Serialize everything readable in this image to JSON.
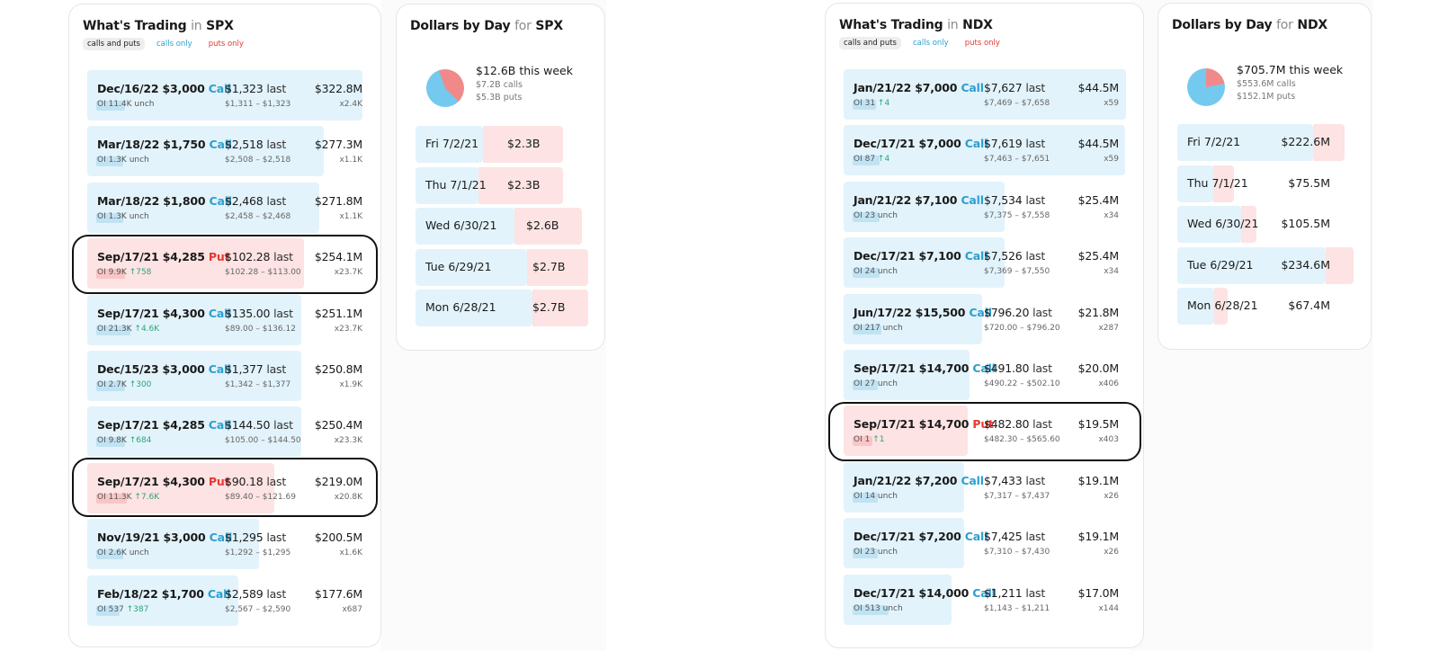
{
  "colors": {
    "call": "#2e9fd0",
    "put": "#e53935",
    "up": "#2aa57a",
    "call_fill": "#e2f3fb",
    "put_fill": "#fde3e3",
    "pie_calls": "#74c9ee",
    "pie_puts": "#f08a8a"
  },
  "panels": {
    "spx_trading": {
      "title_main": "What's Trading",
      "title_in": "in",
      "ticker": "SPX",
      "filters": [
        "calls and puts",
        "calls only",
        "puts only"
      ],
      "rows": [
        {
          "contract": "Dec/16/22 $3,000",
          "type": "Call",
          "last": "$1,323",
          "last_label": "last",
          "oi": "OI 11.4K",
          "change": "unch",
          "range": "$1,311 – $1,323",
          "premium": "$322.8M",
          "mult": "x2.4K"
        },
        {
          "contract": "Mar/18/22 $1,750",
          "type": "Call",
          "last": "$2,518",
          "last_label": "last",
          "oi": "OI 1.3K",
          "change": "unch",
          "range": "$2,508 – $2,518",
          "premium": "$277.3M",
          "mult": "x1.1K"
        },
        {
          "contract": "Mar/18/22 $1,800",
          "type": "Call",
          "last": "$2,468",
          "last_label": "last",
          "oi": "OI 1.3K",
          "change": "unch",
          "range": "$2,458 – $2,468",
          "premium": "$271.8M",
          "mult": "x1.1K"
        },
        {
          "contract": "Sep/17/21 $4,285",
          "type": "Put",
          "last": "$102.28",
          "last_label": "last",
          "oi": "OI 9.9K",
          "change": "↑758",
          "range": "$102.28 – $113.00",
          "premium": "$254.1M",
          "mult": "x23.7K"
        },
        {
          "contract": "Sep/17/21 $4,300",
          "type": "Call",
          "last": "$135.00",
          "last_label": "last",
          "oi": "OI 21.3K",
          "change": "↑4.6K",
          "range": "$89.00 – $136.12",
          "premium": "$251.1M",
          "mult": "x23.7K"
        },
        {
          "contract": "Dec/15/23 $3,000",
          "type": "Call",
          "last": "$1,377",
          "last_label": "last",
          "oi": "OI 2.7K",
          "change": "↑300",
          "range": "$1,342 – $1,377",
          "premium": "$250.8M",
          "mult": "x1.9K"
        },
        {
          "contract": "Sep/17/21 $4,285",
          "type": "Call",
          "last": "$144.50",
          "last_label": "last",
          "oi": "OI 9.8K",
          "change": "↑684",
          "range": "$105.00 – $144.50",
          "premium": "$250.4M",
          "mult": "x23.3K"
        },
        {
          "contract": "Sep/17/21 $4,300",
          "type": "Put",
          "last": "$90.18",
          "last_label": "last",
          "oi": "OI 11.3K",
          "change": "↑7.6K",
          "range": "$89.40 – $121.69",
          "premium": "$219.0M",
          "mult": "x20.8K"
        },
        {
          "contract": "Nov/19/21 $3,000",
          "type": "Call",
          "last": "$1,295",
          "last_label": "last",
          "oi": "OI 2.6K",
          "change": "unch",
          "range": "$1,292 – $1,295",
          "premium": "$200.5M",
          "mult": "x1.6K"
        },
        {
          "contract": "Feb/18/22 $1,700",
          "type": "Call",
          "last": "$2,589",
          "last_label": "last",
          "oi": "OI 537",
          "change": "↑387",
          "range": "$2,567 – $2,590",
          "premium": "$177.6M",
          "mult": "x687"
        }
      ]
    },
    "spx_days": {
      "title_main": "Dollars by Day",
      "title_for": "for",
      "ticker": "SPX",
      "summary": "$12.6B this week",
      "calls": "$7.2B calls",
      "puts": "$5.3B puts",
      "calls_share": 0.57,
      "days": [
        {
          "label": "Fri 7/2/21",
          "value": "$2.3B",
          "total": 2.3,
          "calls": 1.05
        },
        {
          "label": "Thu 7/1/21",
          "value": "$2.3B",
          "total": 2.3,
          "calls": 0.98
        },
        {
          "label": "Wed 6/30/21",
          "value": "$2.6B",
          "total": 2.6,
          "calls": 1.55
        },
        {
          "label": "Tue 6/29/21",
          "value": "$2.7B",
          "total": 2.7,
          "calls": 1.75
        },
        {
          "label": "Mon 6/28/21",
          "value": "$2.7B",
          "total": 2.7,
          "calls": 1.83
        }
      ]
    },
    "ndx_trading": {
      "title_main": "What's Trading",
      "title_in": "in",
      "ticker": "NDX",
      "filters": [
        "calls and puts",
        "calls only",
        "puts only"
      ],
      "rows": [
        {
          "contract": "Jan/21/22 $7,000",
          "type": "Call",
          "last": "$7,627",
          "last_label": "last",
          "oi": "OI 31",
          "change": "↑4",
          "range": "$7,469 – $7,658",
          "premium": "$44.5M",
          "mult": "x59"
        },
        {
          "contract": "Dec/17/21 $7,000",
          "type": "Call",
          "last": "$7,619",
          "last_label": "last",
          "oi": "OI 87",
          "change": "↑4",
          "range": "$7,463 – $7,651",
          "premium": "$44.5M",
          "mult": "x59"
        },
        {
          "contract": "Jan/21/22 $7,100",
          "type": "Call",
          "last": "$7,534",
          "last_label": "last",
          "oi": "OI 23",
          "change": "unch",
          "range": "$7,375 – $7,558",
          "premium": "$25.4M",
          "mult": "x34"
        },
        {
          "contract": "Dec/17/21 $7,100",
          "type": "Call",
          "last": "$7,526",
          "last_label": "last",
          "oi": "OI 24",
          "change": "unch",
          "range": "$7,369 – $7,550",
          "premium": "$25.4M",
          "mult": "x34"
        },
        {
          "contract": "Jun/17/22 $15,500",
          "type": "Call",
          "last": "$796.20",
          "last_label": "last",
          "oi": "OI 217",
          "change": "unch",
          "range": "$720.00 – $796.20",
          "premium": "$21.8M",
          "mult": "x287"
        },
        {
          "contract": "Sep/17/21 $14,700",
          "type": "Call",
          "last": "$491.80",
          "last_label": "last",
          "oi": "OI 27",
          "change": "unch",
          "range": "$490.22 – $502.10",
          "premium": "$20.0M",
          "mult": "x406"
        },
        {
          "contract": "Sep/17/21 $14,700",
          "type": "Put",
          "last": "$482.80",
          "last_label": "last",
          "oi": "OI 1",
          "change": "↑1",
          "range": "$482.30 – $565.60",
          "premium": "$19.5M",
          "mult": "x403"
        },
        {
          "contract": "Jan/21/22 $7,200",
          "type": "Call",
          "last": "$7,433",
          "last_label": "last",
          "oi": "OI 14",
          "change": "unch",
          "range": "$7,317 – $7,437",
          "premium": "$19.1M",
          "mult": "x26"
        },
        {
          "contract": "Dec/17/21 $7,200",
          "type": "Call",
          "last": "$7,425",
          "last_label": "last",
          "oi": "OI 23",
          "change": "unch",
          "range": "$7,310 – $7,430",
          "premium": "$19.1M",
          "mult": "x26"
        },
        {
          "contract": "Dec/17/21 $14,000",
          "type": "Call",
          "last": "$1,211",
          "last_label": "last",
          "oi": "OI 513",
          "change": "unch",
          "range": "$1,143 – $1,211",
          "premium": "$17.0M",
          "mult": "x144"
        }
      ]
    },
    "ndx_days": {
      "title_main": "Dollars by Day",
      "title_for": "for",
      "ticker": "NDX",
      "summary": "$705.7M this week",
      "calls": "$553.6M calls",
      "puts": "$152.1M puts",
      "calls_share": 0.78,
      "days": [
        {
          "label": "Fri 7/2/21",
          "value": "$222.6M",
          "total": 222.6,
          "calls": 181
        },
        {
          "label": "Thu 7/1/21",
          "value": "$75.5M",
          "total": 75.5,
          "calls": 48
        },
        {
          "label": "Wed 6/30/21",
          "value": "$105.5M",
          "total": 105.5,
          "calls": 85
        },
        {
          "label": "Tue 6/29/21",
          "value": "$234.6M",
          "total": 234.6,
          "calls": 197
        },
        {
          "label": "Mon 6/28/21",
          "value": "$67.4M",
          "total": 67.4,
          "calls": 49
        }
      ]
    }
  }
}
